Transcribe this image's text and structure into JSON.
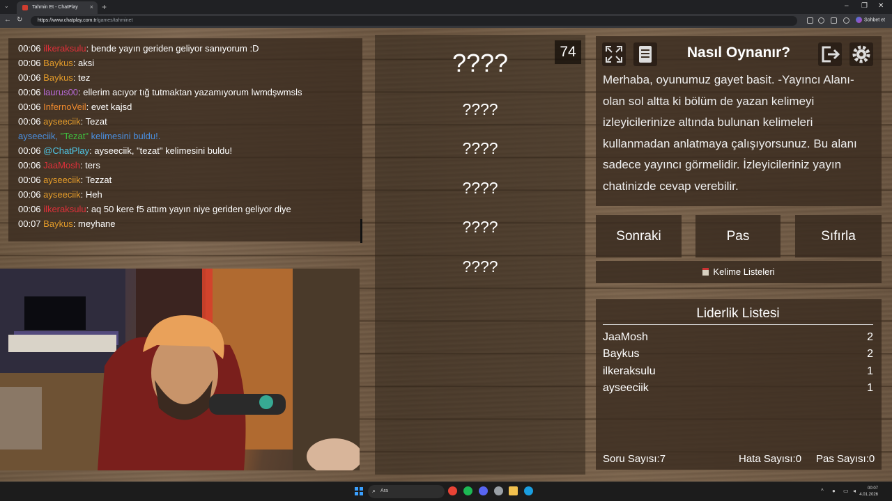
{
  "browser": {
    "tab_title": "Tahmin Et - ChatPlay",
    "url_domain": "https://www.chatplay.com.tr",
    "url_path": "/games/tahminet",
    "sohbet_label": "Sohbet et"
  },
  "chat": {
    "messages": [
      {
        "time": "00:06",
        "user": "ilkeraksulu",
        "color": "#e0303a",
        "text": ": bende yayın geriden geliyor sanıyorum :D"
      },
      {
        "time": "00:06",
        "user": "Baykus",
        "color": "#e39b2a",
        "text": ": aksi"
      },
      {
        "time": "00:06",
        "user": "Baykus",
        "color": "#e39b2a",
        "text": ": tez"
      },
      {
        "time": "00:06",
        "user": "laurus00",
        "color": "#b86ad8",
        "text": ": ellerim acıyor tığ tutmaktan yazamıyorum lwmdşwmsls"
      },
      {
        "time": "00:06",
        "user": "InfernoVeil",
        "color": "#f08a2e",
        "text": ": evet kajsd"
      },
      {
        "time": "00:06",
        "user": "ayseeciik",
        "color": "#e39b2a",
        "text": ": Tezat"
      },
      {
        "system_user": "ayseeciik, ",
        "system_word": "\"Tezat\"",
        "system_rest": " kelimesini buldu!."
      },
      {
        "time": "00:06",
        "user": "@ChatPlay",
        "color": "#4fc8e8",
        "text": ": ayseeciik, \"tezat\" kelimesini buldu!"
      },
      {
        "time": "00:06",
        "user": "JaaMosh",
        "color": "#e0303a",
        "text": ": ters"
      },
      {
        "time": "00:06",
        "user": "ayseeciik",
        "color": "#e39b2a",
        "text": ": Tezzat"
      },
      {
        "time": "00:06",
        "user": "ayseeciik",
        "color": "#e39b2a",
        "text": ": Heh"
      },
      {
        "time": "00:06",
        "user": "ilkeraksulu",
        "color": "#e0303a",
        "text": ": aq 50 kere f5 attım yayın niye geriden geliyor diye"
      },
      {
        "time": "00:07",
        "user": "Baykus",
        "color": "#e39b2a",
        "text": ": meyhane"
      }
    ]
  },
  "game": {
    "timer": "74",
    "words": [
      "????",
      "????",
      "????",
      "????",
      "????",
      "????"
    ]
  },
  "howto": {
    "title": "Nasıl Oynanır?",
    "text": "Merhaba, oyunumuz gayet basit. -Yayıncı Alanı- olan sol altta ki bölüm de yazan kelimeyi izleyicilerinize altında bulunan kelimeleri kullanmadan anlatmaya çalışıyorsunuz. Bu alanı sadece yayıncı görmelidir. İzleyicileriniz yayın chatinizde cevap verebilir."
  },
  "buttons": {
    "next": "Sonraki",
    "pass": "Pas",
    "reset": "Sıfırla",
    "word_lists": "Kelime Listeleri"
  },
  "leaderboard": {
    "title": "Liderlik Listesi",
    "rows": [
      {
        "name": "JaaMosh",
        "score": "2"
      },
      {
        "name": "Baykus",
        "score": "2"
      },
      {
        "name": "ilkeraksulu",
        "score": "1"
      },
      {
        "name": "ayseeciik",
        "score": "1"
      }
    ]
  },
  "stats": {
    "questions": "Soru Sayısı:7",
    "errors": "Hata Sayısı:0",
    "passes": "Pas Sayısı:0"
  },
  "taskbar": {
    "search_placeholder": "Ara",
    "time": "00:07",
    "date": "4.01.2026"
  },
  "colors": {
    "system_green": "#3fbf3f",
    "system_blue": "#4a8fe0"
  }
}
